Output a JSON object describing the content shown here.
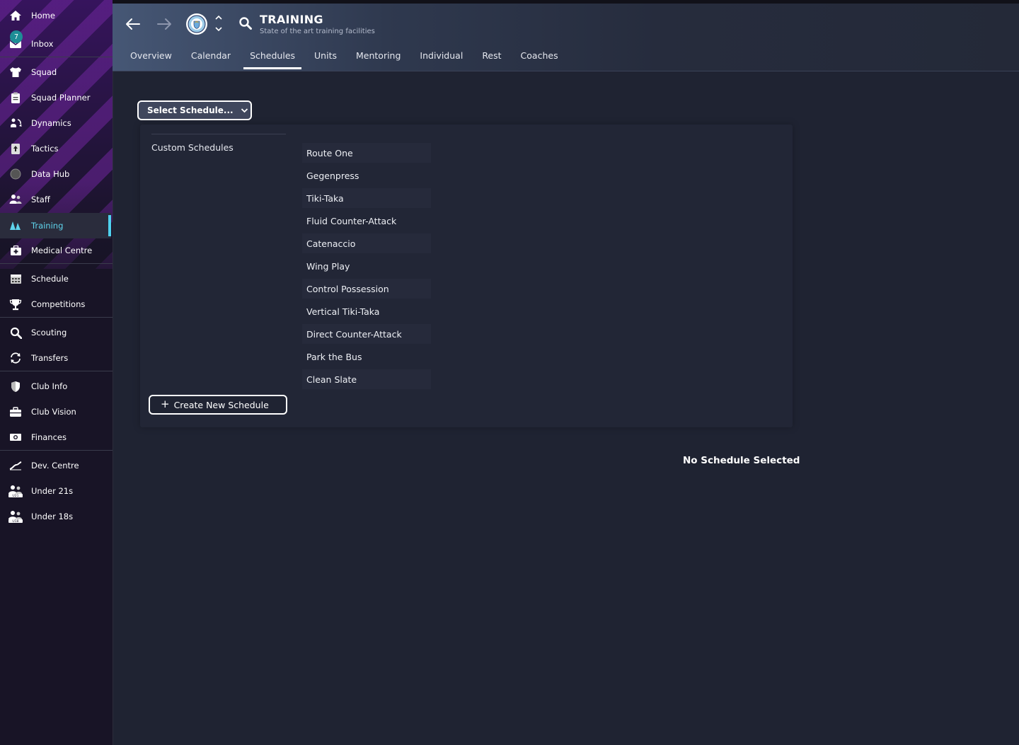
{
  "sidebar": {
    "inbox_badge": "7",
    "items": [
      {
        "label": "Home",
        "icon": "home-icon"
      },
      {
        "label": "Inbox",
        "icon": "inbox-icon"
      },
      {
        "label": "Squad",
        "icon": "shirt-icon"
      },
      {
        "label": "Squad Planner",
        "icon": "clipboard-icon"
      },
      {
        "label": "Dynamics",
        "icon": "dynamics-icon"
      },
      {
        "label": "Tactics",
        "icon": "tactics-board-icon"
      },
      {
        "label": "Data Hub",
        "icon": "data-hub-icon"
      },
      {
        "label": "Staff",
        "icon": "staff-icon"
      },
      {
        "label": "Training",
        "icon": "training-cone-icon",
        "active": true
      },
      {
        "label": "Medical Centre",
        "icon": "medical-kit-icon"
      },
      {
        "label": "Schedule",
        "icon": "calendar-icon"
      },
      {
        "label": "Competitions",
        "icon": "trophy-icon"
      },
      {
        "label": "Scouting",
        "icon": "magnifier-icon"
      },
      {
        "label": "Transfers",
        "icon": "transfer-arrows-icon"
      },
      {
        "label": "Club Info",
        "icon": "shield-icon"
      },
      {
        "label": "Club Vision",
        "icon": "briefcase-icon"
      },
      {
        "label": "Finances",
        "icon": "money-icon"
      },
      {
        "label": "Dev. Centre",
        "icon": "dev-centre-icon"
      },
      {
        "label": "Under 21s",
        "icon": "u21-team-icon"
      },
      {
        "label": "Under 18s",
        "icon": "u18-team-icon"
      }
    ]
  },
  "header": {
    "title": "TRAINING",
    "subtitle": "State of the art training facilities",
    "tabs": [
      "Overview",
      "Calendar",
      "Schedules",
      "Units",
      "Mentoring",
      "Individual",
      "Rest",
      "Coaches"
    ],
    "active_tab": "Schedules"
  },
  "main": {
    "select_label": "Select Schedule...",
    "custom_schedules_label": "Custom Schedules",
    "schedules": [
      "Route One",
      "Gegenpress",
      "Tiki-Taka",
      "Fluid Counter-Attack",
      "Catenaccio",
      "Wing Play",
      "Control Possession",
      "Vertical Tiki-Taka",
      "Direct Counter-Attack",
      "Park the Bus",
      "Clean Slate"
    ],
    "create_label": "Create New Schedule",
    "empty_state": "No Schedule Selected"
  },
  "colors": {
    "accent": "#4fd2ee",
    "sidebar_bg": "#181426",
    "content_bg": "#1f2332",
    "badge": "#1d8d96"
  }
}
